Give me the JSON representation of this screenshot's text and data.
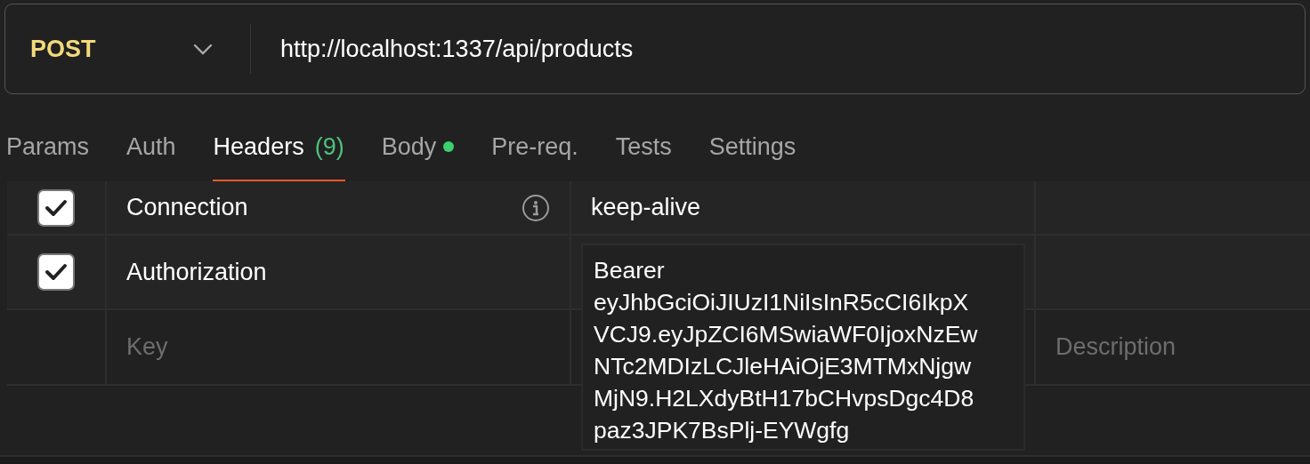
{
  "request": {
    "method": "POST",
    "url": "http://localhost:1337/api/products"
  },
  "tabs": [
    {
      "label": "Params",
      "selected": false,
      "dot": false
    },
    {
      "label": "Auth",
      "selected": false,
      "dot": false
    },
    {
      "label": "Headers",
      "count": "(9)",
      "selected": true,
      "dot": false
    },
    {
      "label": "Body",
      "selected": false,
      "dot": true
    },
    {
      "label": "Pre-req.",
      "selected": false,
      "dot": false
    },
    {
      "label": "Tests",
      "selected": false,
      "dot": false
    },
    {
      "label": "Settings",
      "selected": false,
      "dot": false
    }
  ],
  "headers": [
    {
      "checked": true,
      "key": "Connection",
      "info": true,
      "value": "keep-alive",
      "expanded": false
    },
    {
      "checked": true,
      "key": "Authorization",
      "info": false,
      "value": "Bearer eyJhbGciOiJIUzI1NiIsInR5cCI6IkpXVCJ9.eyJpZCI6MSwiaWF0IjoxNzEwNTc2MDIzLCJleHAiOjE3MTMxNjgwMjN9.H2LXdyBtH17bCHvpsDgc4D8paz3JPK7BsPlj-EYWgfg",
      "expanded": true
    }
  ],
  "new_row": {
    "key_placeholder": "Key",
    "description_placeholder": "Description"
  }
}
